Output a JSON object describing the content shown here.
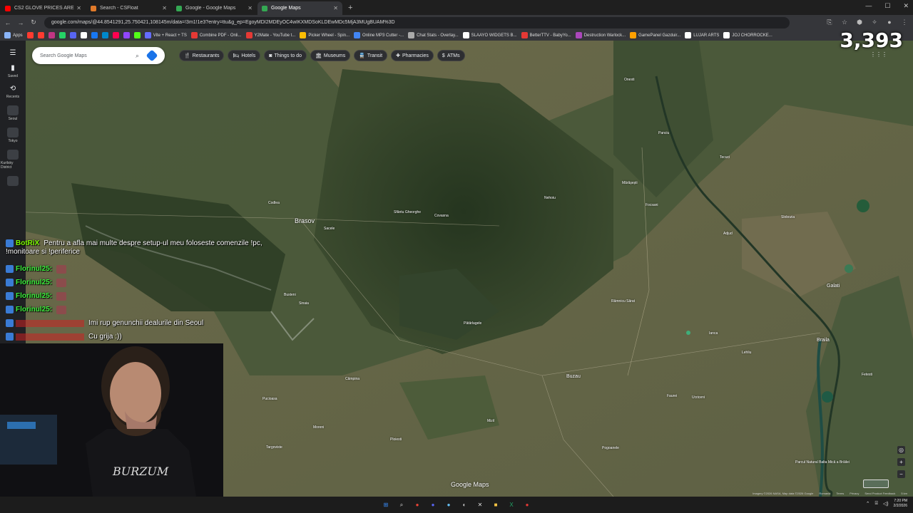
{
  "browser": {
    "tabs": [
      {
        "label": "CS2 GLOVE PRICES ARE FAKE...",
        "icon": "youtube-icon",
        "color": "#ff0000",
        "active": false
      },
      {
        "label": "Search - CSFloat",
        "icon": "csfloat-icon",
        "color": "#e07a2a",
        "active": false
      },
      {
        "label": "Google - Google Maps",
        "icon": "google-maps-icon",
        "color": "#34a853",
        "active": false
      },
      {
        "label": "Google Maps",
        "icon": "google-maps-icon",
        "color": "#34a853",
        "active": true
      }
    ],
    "url": "google.com/maps/@44.8541291,25.750421,108145m/data=!3m1!1e3?entry=ttu&g_ep=EgoyMDI2MDEyOC4wIKXMDSoKLDEwMDc5MjA3MUgBUAM%3D",
    "bookmarks": [
      {
        "label": "Apps",
        "color": "#8ab4f8"
      },
      {
        "label": "",
        "color": "#ff3b30"
      },
      {
        "label": "",
        "color": "#ff3b30"
      },
      {
        "label": "",
        "color": "#c13584"
      },
      {
        "label": "",
        "color": "#25d366"
      },
      {
        "label": "",
        "color": "#5865f2"
      },
      {
        "label": "",
        "color": "#ffffff"
      },
      {
        "label": "",
        "color": "#1877f2"
      },
      {
        "label": "",
        "color": "#0088cc"
      },
      {
        "label": "",
        "color": "#ff0050"
      },
      {
        "label": "",
        "color": "#9146ff"
      },
      {
        "label": "",
        "color": "#53fc18"
      },
      {
        "label": "Vite + React + TS",
        "color": "#646cff"
      },
      {
        "label": "Combine PDF - Onli...",
        "color": "#e53935"
      },
      {
        "label": "Y2Mate - YouTube t...",
        "color": "#e53935"
      },
      {
        "label": "Picker Wheel - Spin...",
        "color": "#fbbc04"
      },
      {
        "label": "Online MP3 Cutter -...",
        "color": "#4285f4"
      },
      {
        "label": "Chat Stats - Overlay...",
        "color": "#aaaaaa"
      },
      {
        "label": "SLAAYO WIDGETS B...",
        "color": "#ffffff"
      },
      {
        "label": "BetterTTV - BabyYo...",
        "color": "#e53935"
      },
      {
        "label": "Destruction Warlock...",
        "color": "#ab47bc"
      },
      {
        "label": "GamePanel Gazduir...",
        "color": "#ffa000"
      },
      {
        "label": "LUJAR ARTS",
        "color": "#ffffff"
      },
      {
        "label": "JOJ CHORROCKE...",
        "color": "#ffffff"
      }
    ]
  },
  "maps": {
    "search_placeholder": "Search Google Maps",
    "rail": [
      {
        "label": "",
        "icon": "menu-icon",
        "glyph": "☰"
      },
      {
        "label": "Saved",
        "icon": "bookmark-icon",
        "glyph": "🔖"
      },
      {
        "label": "Recents",
        "icon": "history-icon",
        "glyph": "⟲"
      },
      {
        "label": "Seoul",
        "icon": "recent-place-thumb",
        "glyph": ""
      },
      {
        "label": "Tokyo",
        "icon": "recent-place-thumb",
        "glyph": ""
      },
      {
        "label": "Kurilsky District",
        "icon": "recent-place-thumb",
        "glyph": ""
      },
      {
        "label": "",
        "icon": "recent-place-thumb",
        "glyph": ""
      }
    ],
    "chips": [
      {
        "label": "Restaurants",
        "icon": "restaurant-icon",
        "glyph": "🍴"
      },
      {
        "label": "Hotels",
        "icon": "hotel-icon",
        "glyph": "🛏"
      },
      {
        "label": "Things to do",
        "icon": "camera-icon",
        "glyph": "◙"
      },
      {
        "label": "Museums",
        "icon": "museum-icon",
        "glyph": "🏛"
      },
      {
        "label": "Transit",
        "icon": "transit-icon",
        "glyph": "🚆"
      },
      {
        "label": "Pharmacies",
        "icon": "pharmacy-icon",
        "glyph": "✚"
      },
      {
        "label": "ATMs",
        "icon": "atm-icon",
        "glyph": "$"
      }
    ],
    "places": [
      {
        "name": "Brasov",
        "size": "big"
      },
      {
        "name": "Galati",
        "size": "mid"
      },
      {
        "name": "Braila",
        "size": "mid"
      },
      {
        "name": "Buzau",
        "size": "mid"
      },
      {
        "name": "Focsani",
        "size": "small"
      },
      {
        "name": "Tecuci",
        "size": "small"
      },
      {
        "name": "Ploiesti",
        "size": "small"
      },
      {
        "name": "Targoviste",
        "size": "small"
      },
      {
        "name": "Râmnicu Sărat",
        "size": "small"
      },
      {
        "name": "Sacele",
        "size": "small"
      },
      {
        "name": "Codlea",
        "size": "small"
      },
      {
        "name": "Sfântu Gheorghe",
        "size": "small"
      },
      {
        "name": "Covasna",
        "size": "small"
      },
      {
        "name": "Nehoiu",
        "size": "small"
      },
      {
        "name": "Pătârlagele",
        "size": "small"
      },
      {
        "name": "Mizil",
        "size": "small"
      },
      {
        "name": "Urziceni",
        "size": "small"
      },
      {
        "name": "Slobozia",
        "size": "small"
      },
      {
        "name": "Fetesti",
        "size": "small"
      },
      {
        "name": "Câmpina",
        "size": "small"
      },
      {
        "name": "Sinaia",
        "size": "small"
      },
      {
        "name": "Busteni",
        "size": "small"
      },
      {
        "name": "Pucioasa",
        "size": "small"
      },
      {
        "name": "Moreni",
        "size": "small"
      },
      {
        "name": "Adjud",
        "size": "small"
      },
      {
        "name": "Onesti",
        "size": "small"
      },
      {
        "name": "Panciu",
        "size": "small"
      },
      {
        "name": "Mărășești",
        "size": "small"
      },
      {
        "name": "Lehliu",
        "size": "small"
      },
      {
        "name": "Ianca",
        "size": "small"
      },
      {
        "name": "Faurei",
        "size": "small"
      },
      {
        "name": "Pogoanele",
        "size": "small"
      },
      {
        "name": "Parcul Natural Balta Mică a Brăilei",
        "size": "small"
      }
    ],
    "controls": [
      {
        "glyph": "◎",
        "icon": "my-location-icon"
      },
      {
        "glyph": "+",
        "icon": "zoom-in-icon"
      },
      {
        "glyph": "−",
        "icon": "zoom-out-icon"
      }
    ],
    "google_logo": "Google Maps",
    "footer": [
      "Imagery ©2026 NASA, Map data ©2026 Google",
      "Romania",
      "Terms",
      "Privacy",
      "Send Product Feedback",
      "5 km"
    ]
  },
  "overlay": {
    "viewer_count": "3,393",
    "chat": [
      {
        "user": "BotRiX",
        "user_color": "#7CFC00",
        "message": "Pentru a afla mai multe despre setup-ul meu foloseste comenzile !pc, !monitoare si !periferice",
        "emote": false
      },
      {
        "user": "Florinul25:",
        "user_color": "#3df03d",
        "message": "",
        "emote": true
      },
      {
        "user": "Florinul25:",
        "user_color": "#3df03d",
        "message": "",
        "emote": true
      },
      {
        "user": "Florinul25:",
        "user_color": "#3df03d",
        "message": "",
        "emote": true
      },
      {
        "user": "Florinul25:",
        "user_color": "#3df03d",
        "message": "",
        "emote": true
      },
      {
        "user": "",
        "user_color": "#cc2222",
        "message": "Imi rup genunchii dealurile din Seoul",
        "emote": false
      },
      {
        "user": "",
        "user_color": "#cc2222",
        "message": "Cu grija :))",
        "emote": false
      }
    ]
  },
  "taskbar": {
    "apps": [
      {
        "icon": "windows-start-icon",
        "color": "#3a8fff",
        "glyph": "⊞"
      },
      {
        "icon": "search-icon",
        "color": "#dddddd",
        "glyph": "⌕"
      },
      {
        "icon": "chrome-icon",
        "color": "#ea4335",
        "glyph": "●"
      },
      {
        "icon": "discord-icon",
        "color": "#5865f2",
        "glyph": "●"
      },
      {
        "icon": "steam-icon",
        "color": "#66c0f4",
        "glyph": "●"
      },
      {
        "icon": "obs-icon",
        "color": "#cccccc",
        "glyph": "◐"
      },
      {
        "icon": "capcut-icon",
        "color": "#dddddd",
        "glyph": "✕"
      },
      {
        "icon": "file-explorer-icon",
        "color": "#f6c344",
        "glyph": "■"
      },
      {
        "icon": "excel-icon",
        "color": "#21a366",
        "glyph": "X"
      },
      {
        "icon": "app-icon",
        "color": "#e53935",
        "glyph": "●"
      }
    ],
    "time": "7:20 PM",
    "date": "2/2/2026"
  }
}
